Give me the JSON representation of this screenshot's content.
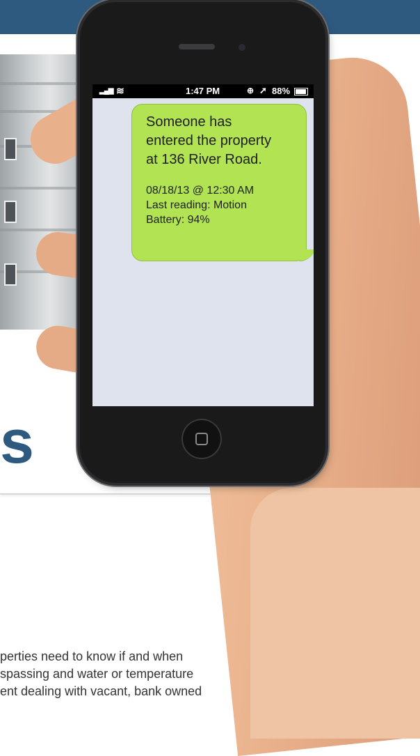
{
  "phone": {
    "status_bar": {
      "signal": "▂▄▆",
      "wifi": "≋",
      "time": "1:47 PM",
      "lock": "⊕",
      "location": "➚",
      "battery": "88%"
    },
    "message": {
      "line1": "Someone has",
      "line2": "entered the property",
      "line3": "at 136 River Road.",
      "timestamp": "08/18/13 @ 12:30 AM",
      "reading": "Last reading: Motion",
      "battery": "Battery: 94%"
    }
  },
  "page": {
    "big_letter": "s",
    "body_lines": [
      "perties need to know if and when",
      "spassing and water or temperature",
      "ent dealing with vacant, bank owned",
      "                                    "
    ]
  },
  "colors": {
    "banner": "#2f5a80",
    "bubble": "#b1e353",
    "screen_bg": "#dfe3ee"
  }
}
